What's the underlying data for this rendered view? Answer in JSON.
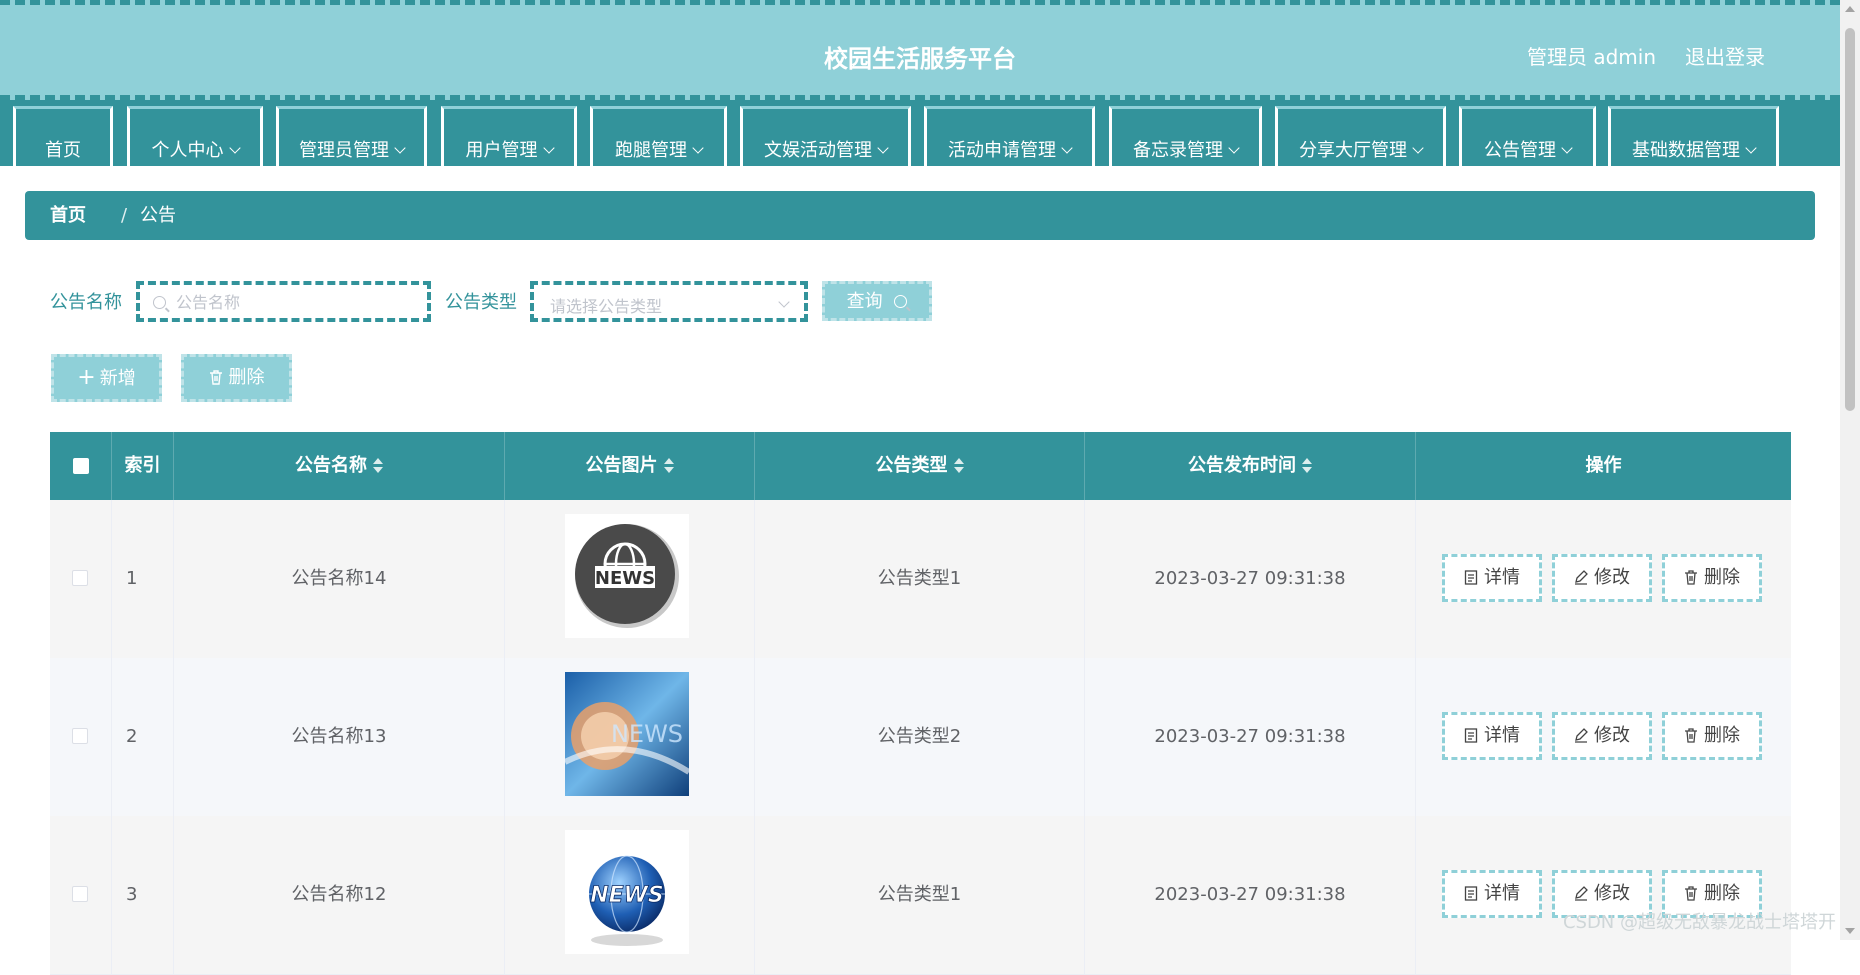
{
  "header": {
    "title": "校园生活服务平台",
    "admin_label": "管理员 admin",
    "logout_label": "退出登录"
  },
  "nav": {
    "items": [
      {
        "label": "首页",
        "has_dropdown": false
      },
      {
        "label": "个人中心",
        "has_dropdown": true
      },
      {
        "label": "管理员管理",
        "has_dropdown": true
      },
      {
        "label": "用户管理",
        "has_dropdown": true
      },
      {
        "label": "跑腿管理",
        "has_dropdown": true
      },
      {
        "label": "文娱活动管理",
        "has_dropdown": true
      },
      {
        "label": "活动申请管理",
        "has_dropdown": true
      },
      {
        "label": "备忘录管理",
        "has_dropdown": true
      },
      {
        "label": "分享大厅管理",
        "has_dropdown": true
      },
      {
        "label": "公告管理",
        "has_dropdown": true
      },
      {
        "label": "基础数据管理",
        "has_dropdown": true
      }
    ]
  },
  "breadcrumb": {
    "home": "首页",
    "separator": "/",
    "current": "公告"
  },
  "search": {
    "name_label": "公告名称",
    "name_placeholder": "公告名称",
    "type_label": "公告类型",
    "type_placeholder": "请选择公告类型",
    "query_label": "查询"
  },
  "toolbar": {
    "add_label": "新增",
    "delete_label": "删除"
  },
  "table": {
    "columns": {
      "index": "索引",
      "name": "公告名称",
      "image": "公告图片",
      "type": "公告类型",
      "time": "公告发布时间",
      "actions": "操作"
    },
    "rows": [
      {
        "index": "1",
        "name": "公告名称14",
        "image": "news-globe-dark",
        "type": "公告类型1",
        "time": "2023-03-27 09:31:38"
      },
      {
        "index": "2",
        "name": "公告名称13",
        "image": "news-blue-abstract",
        "type": "公告类型2",
        "time": "2023-03-27 09:31:38"
      },
      {
        "index": "3",
        "name": "公告名称12",
        "image": "news-blue-globe",
        "type": "公告类型1",
        "time": "2023-03-27 09:31:38"
      }
    ],
    "actions": {
      "detail": "详情",
      "edit": "修改",
      "delete": "删除"
    }
  },
  "watermark": "CSDN @超级无敌暴龙战士塔塔开",
  "colors": {
    "primary": "#33939b",
    "light": "#8fd0d8",
    "text": "#606266"
  }
}
